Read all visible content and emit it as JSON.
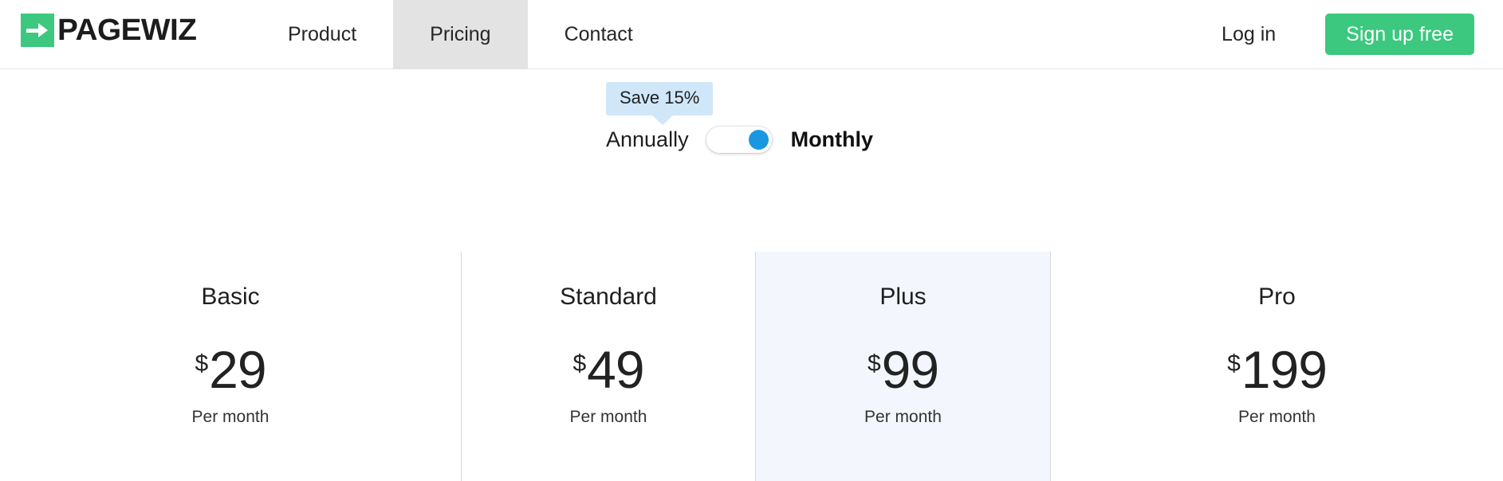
{
  "header": {
    "logo": {
      "icon": "arrow-right-icon",
      "wordmark": "PAGEWIZ"
    },
    "nav": [
      {
        "label": "Product",
        "active": false
      },
      {
        "label": "Pricing",
        "active": true
      },
      {
        "label": "Contact",
        "active": false
      }
    ],
    "login_label": "Log in",
    "signup_label": "Sign up free",
    "accent_green": "#3cc87e"
  },
  "billing": {
    "save_badge": "Save 15%",
    "annually_label": "Annually",
    "monthly_label": "Monthly",
    "selected": "Monthly",
    "toggle_knob_color": "#1b97e0",
    "badge_color": "#cfe7f8"
  },
  "plans": [
    {
      "name": "Basic",
      "currency": "$",
      "amount": "29",
      "period": "Per month",
      "featured": false
    },
    {
      "name": "Standard",
      "currency": "$",
      "amount": "49",
      "period": "Per month",
      "featured": false
    },
    {
      "name": "Plus",
      "currency": "$",
      "amount": "99",
      "period": "Per month",
      "featured": true,
      "highlight_color": "#f3f7fd"
    },
    {
      "name": "Pro",
      "currency": "$",
      "amount": "199",
      "period": "Per month",
      "featured": false
    }
  ]
}
